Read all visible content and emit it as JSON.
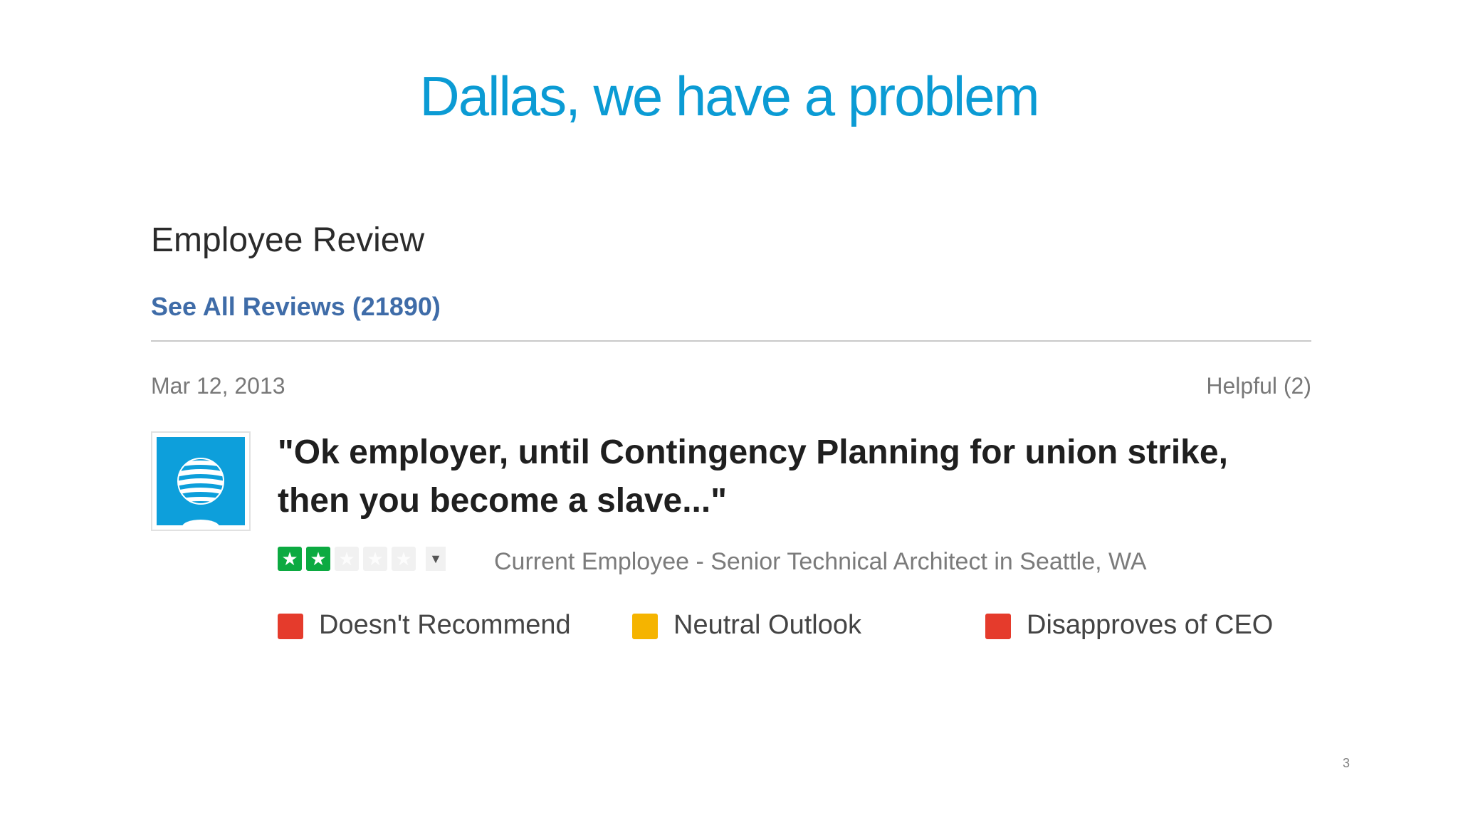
{
  "slide": {
    "title": "Dallas, we have a problem",
    "page_number": "3",
    "title_color": "#0b9bd4"
  },
  "review": {
    "section_heading": "Employee Review",
    "see_all_link": "See All Reviews (21890)",
    "date": "Mar 12, 2013",
    "helpful": "Helpful (2)",
    "company_logo_icon": "att-globe-logo",
    "title": "\"Ok employer, until Contingency Planning for union strike, then you become a slave...\"",
    "rating": {
      "stars_filled": 2,
      "stars_total": 5,
      "star_color": "#0caa41"
    },
    "employee_info": "Current Employee - Senior Technical Architect in Seattle, WA",
    "indicators": [
      {
        "label": "Doesn't Recommend",
        "color": "#e53b2c"
      },
      {
        "label": "Neutral Outlook",
        "color": "#f5b400"
      },
      {
        "label": "Disapproves of CEO",
        "color": "#e53b2c"
      }
    ]
  }
}
